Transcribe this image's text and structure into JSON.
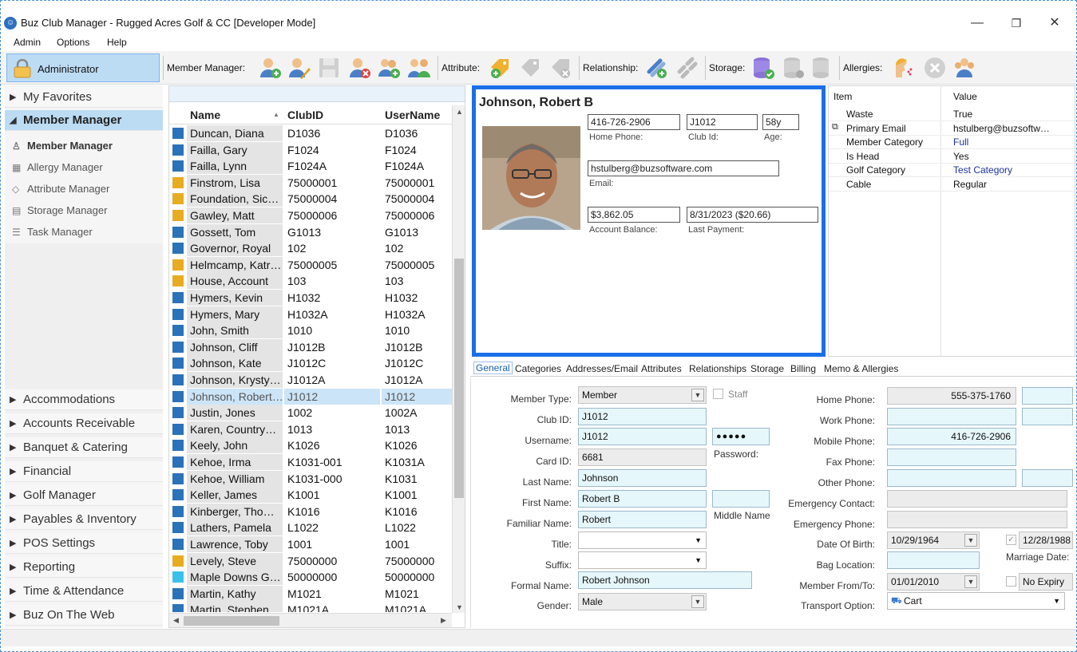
{
  "window": {
    "title": "Buz Club Manager - Rugged Acres Golf & CC [Developer Mode]",
    "minimize": "—",
    "maximize": "❐",
    "close": "✕"
  },
  "menu": [
    "Admin",
    "Options",
    "Help"
  ],
  "toolbar": {
    "admin_label": "Administrator",
    "member_manager_label": "Member Manager:",
    "attribute_label": "Attribute:",
    "relationship_label": "Relationship:",
    "storage_label": "Storage:",
    "allergies_label": "Allergies:"
  },
  "nav": {
    "favorites": "My Favorites",
    "member_manager": "Member Manager",
    "sub_items": [
      "Member Manager",
      "Allergy Manager",
      "Attribute Manager",
      "Storage Manager",
      "Task Manager"
    ],
    "modules": [
      "Accommodations",
      "Accounts Receivable",
      "Banquet & Catering",
      "Financial",
      "Golf Manager",
      "Payables & Inventory",
      "POS Settings",
      "Reporting",
      "Time & Attendance",
      "Buz On The Web"
    ]
  },
  "list": {
    "columns": [
      "Name",
      "ClubID",
      "UserName"
    ],
    "rows": [
      {
        "name": "Duncan, Diana",
        "club": "D1036",
        "user": "D1036",
        "color": "#2c72b8"
      },
      {
        "name": "Failla, Gary",
        "club": "F1024",
        "user": "F1024",
        "color": "#2c72b8"
      },
      {
        "name": "Failla, Lynn",
        "club": "F1024A",
        "user": "F1024A",
        "color": "#2c72b8"
      },
      {
        "name": "Finstrom, Lisa",
        "club": "75000001",
        "user": "75000001",
        "color": "#e8ac22"
      },
      {
        "name": "Foundation,  Sic…",
        "club": "75000004",
        "user": "75000004",
        "color": "#e8ac22"
      },
      {
        "name": "Gawley, Matt",
        "club": "75000006",
        "user": "75000006",
        "color": "#e8ac22"
      },
      {
        "name": "Gossett, Tom",
        "club": "G1013",
        "user": "G1013",
        "color": "#2c72b8"
      },
      {
        "name": "Governor, Royal",
        "club": "102",
        "user": "102",
        "color": "#2c72b8"
      },
      {
        "name": "Helmcamp,  Katr…",
        "club": "75000005",
        "user": "75000005",
        "color": "#e8ac22"
      },
      {
        "name": "House, Account",
        "club": "103",
        "user": "103",
        "color": "#e8ac22"
      },
      {
        "name": "Hymers, Kevin",
        "club": "H1032",
        "user": "H1032",
        "color": "#2c72b8"
      },
      {
        "name": "Hymers, Mary",
        "club": "H1032A",
        "user": "H1032A",
        "color": "#2c72b8"
      },
      {
        "name": "John, Smith",
        "club": "1010",
        "user": "1010",
        "color": "#2c72b8"
      },
      {
        "name": "Johnson, Cliff",
        "club": "J1012B",
        "user": "J1012B",
        "color": "#2c72b8"
      },
      {
        "name": "Johnson, Kate",
        "club": "J1012C",
        "user": "J1012C",
        "color": "#2c72b8"
      },
      {
        "name": "Johnson,  Krysty…",
        "club": "J1012A",
        "user": "J1012A",
        "color": "#2c72b8"
      },
      {
        "name": "Johnson,  Robert…",
        "club": "J1012",
        "user": "J1012",
        "color": "#2c72b8",
        "selected": true
      },
      {
        "name": "Justin, Jones",
        "club": "1002",
        "user": "1002A",
        "color": "#2c72b8"
      },
      {
        "name": "Karen,  Country…",
        "club": "1013",
        "user": "1013",
        "color": "#2c72b8"
      },
      {
        "name": "Keely, John",
        "club": "K1026",
        "user": "K1026",
        "color": "#2c72b8"
      },
      {
        "name": "Kehoe, Irma",
        "club": "K1031-001",
        "user": "K1031A",
        "color": "#2c72b8"
      },
      {
        "name": "Kehoe, William",
        "club": "K1031-000",
        "user": "K1031",
        "color": "#2c72b8"
      },
      {
        "name": "Keller, James",
        "club": "K1001",
        "user": "K1001",
        "color": "#2c72b8"
      },
      {
        "name": "Kinberger,  Tho…",
        "club": "K1016",
        "user": "K1016",
        "color": "#2c72b8"
      },
      {
        "name": "Lathers, Pamela",
        "club": "L1022",
        "user": "L1022",
        "color": "#2c72b8"
      },
      {
        "name": "Lawrence, Toby",
        "club": "1001",
        "user": "1001",
        "color": "#2c72b8"
      },
      {
        "name": "Levely, Steve",
        "club": "75000000",
        "user": "75000000",
        "color": "#e8ac22"
      },
      {
        "name": "Maple Downs  G…",
        "club": "50000000",
        "user": "50000000",
        "color": "#3cc0ea"
      },
      {
        "name": "Martin, Kathy",
        "club": "M1021",
        "user": "M1021",
        "color": "#2c72b8"
      },
      {
        "name": "Martin, Stephen",
        "club": "M1021A",
        "user": "M1021A",
        "color": "#2c72b8"
      }
    ]
  },
  "profile": {
    "name": "Johnson, Robert B",
    "home_phone": "416-726-2906",
    "home_phone_label": "Home Phone:",
    "club_id": "J1012",
    "club_id_label": "Club Id:",
    "age": "58y",
    "age_label": "Age:",
    "email": "hstulberg@buzsoftware.com",
    "email_label": "Email:",
    "balance": "$3,862.05",
    "balance_label": "Account Balance:",
    "last_payment": "8/31/2023 ($20.66)",
    "last_payment_label": "Last Payment:"
  },
  "props": {
    "headers": [
      "Item",
      "Value"
    ],
    "rows": [
      {
        "k": "Waste",
        "v": "True",
        "blue": false
      },
      {
        "k": "Primary Email",
        "v": "hstulberg@buzsoftw…",
        "blue": false,
        "icon": true
      },
      {
        "k": "Member Category",
        "v": "Full",
        "blue": true
      },
      {
        "k": "Is Head",
        "v": "Yes",
        "blue": false
      },
      {
        "k": "Golf Category",
        "v": "Test Category",
        "blue": true
      },
      {
        "k": "Cable",
        "v": "Regular",
        "blue": false
      }
    ]
  },
  "tabs": [
    "General",
    "Categories",
    "Addresses/Email",
    "Attributes",
    "Relationships",
    "Storage",
    "Billing",
    "Memo & Allergies"
  ],
  "form": {
    "member_type_label": "Member Type:",
    "member_type": "Member",
    "staff_label": "Staff",
    "club_id_label": "Club ID:",
    "club_id": "J1012",
    "username_label": "Username:",
    "username": "J1012",
    "password_label": "Password:",
    "password": "●●●●●",
    "card_id_label": "Card ID:",
    "card_id": "6681",
    "last_name_label": "Last Name:",
    "last_name": "Johnson",
    "first_name_label": "First Name:",
    "first_name": "Robert B",
    "middle_name_label": "Middle Name",
    "familiar_name_label": "Familiar Name:",
    "familiar_name": "Robert",
    "title_label": "Title:",
    "suffix_label": "Suffix:",
    "formal_name_label": "Formal Name:",
    "formal_name": "Robert Johnson",
    "gender_label": "Gender:",
    "gender": "Male",
    "home_phone_label": "Home Phone:",
    "home_phone": "555-375-1760",
    "work_phone_label": "Work Phone:",
    "mobile_phone_label": "Mobile Phone:",
    "mobile_phone": "416-726-2906",
    "fax_phone_label": "Fax Phone:",
    "other_phone_label": "Other Phone:",
    "emergency_contact_label": "Emergency Contact:",
    "emergency_phone_label": "Emergency Phone:",
    "dob_label": "Date Of Birth:",
    "dob": "10/29/1964",
    "marriage_date": "12/28/1988",
    "marriage_label": "Marriage Date:",
    "bag_location_label": "Bag Location:",
    "member_from_label": "Member From/To:",
    "member_from": "01/01/2010",
    "no_expiry": "No Expiry",
    "transport_label": "Transport Option:",
    "transport": "Cart"
  }
}
